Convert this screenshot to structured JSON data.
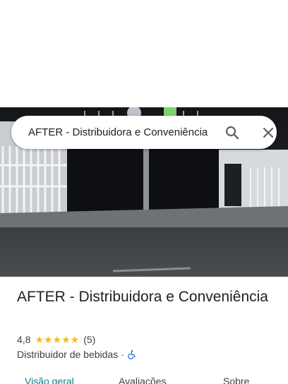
{
  "search": {
    "value": "AFTER - Distribuidora e Conveniência",
    "search_icon": "search-icon",
    "close_icon": "close-icon"
  },
  "place": {
    "name": "AFTER - Distribuidora e Conveniência",
    "rating": "4,8",
    "stars": "★★★★★",
    "review_count": "(5)",
    "category": "Distribuidor de bebidas",
    "separator": "·",
    "accessibility_icon": "wheelchair-icon"
  },
  "tabs": [
    {
      "label": "Visão geral",
      "active": true
    },
    {
      "label": "Avaliações",
      "active": false
    },
    {
      "label": "Sobre",
      "active": false
    }
  ],
  "colors": {
    "accent": "#0b7e89",
    "star": "#fbbc04",
    "accessibility": "#1a73e8"
  }
}
